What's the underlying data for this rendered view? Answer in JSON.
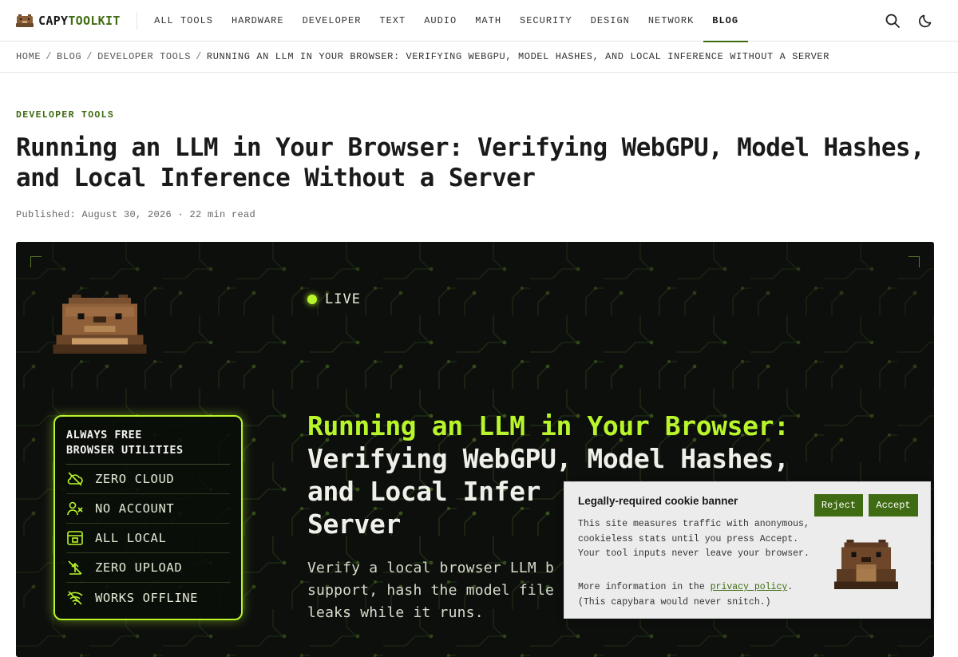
{
  "logo": {
    "brand_main": "CAPY",
    "brand_accent": "TOOLKIT",
    "icon": "capybara-icon"
  },
  "nav": {
    "items": [
      "ALL TOOLS",
      "HARDWARE",
      "DEVELOPER",
      "TEXT",
      "AUDIO",
      "MATH",
      "SECURITY",
      "DESIGN",
      "NETWORK",
      "BLOG"
    ],
    "active": "BLOG",
    "icons": [
      "search-icon",
      "moon-icon"
    ]
  },
  "breadcrumb": {
    "home": "HOME",
    "blog": "BLOG",
    "section": "DEVELOPER TOOLS",
    "current": "RUNNING AN LLM IN YOUR BROWSER: VERIFYING WEBGPU, MODEL HASHES, AND LOCAL INFERENCE WITHOUT A SERVER",
    "separator": "/"
  },
  "article": {
    "category": "DEVELOPER TOOLS",
    "title": "Running an LLM in Your Browser: Verifying WebGPU, Model Hashes, and Local Inference Without a Server",
    "meta": "Published: August 30, 2026 · 22 min read"
  },
  "hero": {
    "live": "LIVE",
    "badge_heading_1": "ALWAYS FREE",
    "badge_heading_2": "BROWSER UTILITIES",
    "badge_items": [
      {
        "label": "ZERO CLOUD",
        "icon": "cloud-off-icon"
      },
      {
        "label": "NO ACCOUNT",
        "icon": "user-x-icon"
      },
      {
        "label": "ALL LOCAL",
        "icon": "local-drive-icon"
      },
      {
        "label": "ZERO UPLOAD",
        "icon": "upload-off-icon"
      },
      {
        "label": "WORKS OFFLINE",
        "icon": "wifi-off-icon"
      }
    ],
    "title_highlight": "Running an LLM in Your Browser:",
    "title_rest_1": "Verifying WebGPU, Model Hashes,",
    "title_rest_2": "and Local Infer",
    "title_rest_3": "Server",
    "desc_1": "Verify a local browser LLM b",
    "desc_2": "support, hash the model file",
    "desc_3": "leaks while it runs.",
    "accent_color": "#b8f52a"
  },
  "cookie": {
    "title": "Legally-required cookie banner",
    "reject": "Reject",
    "accept": "Accept",
    "body": "This site measures traffic with anonymous, cookieless stats until you press Accept. Your tool inputs never leave your browser.",
    "more_prefix": "More information in the ",
    "link": "privacy policy",
    "more_suffix": ".",
    "aside": "(This capybara would never snitch.)"
  },
  "colors": {
    "brand": "#3f6b12",
    "hero_bg": "#0d0f0d",
    "neon": "#b8f52a"
  }
}
